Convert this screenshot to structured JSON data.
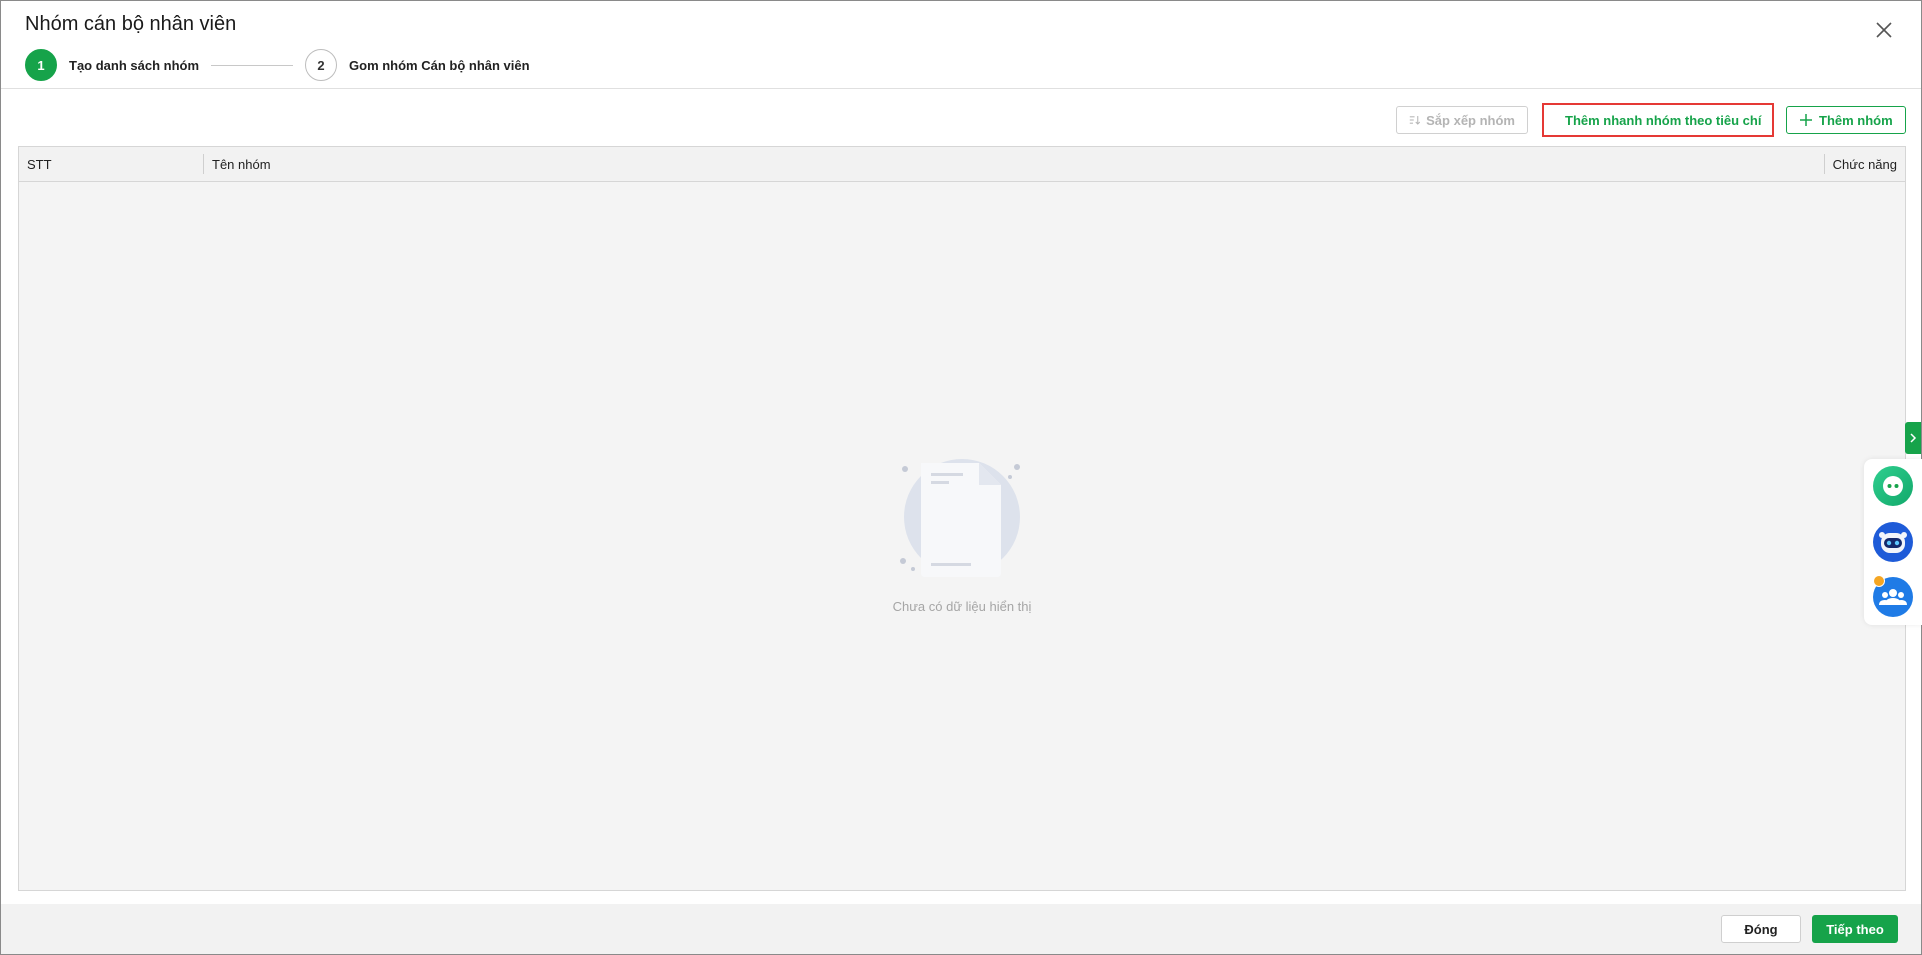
{
  "dialog": {
    "title": "Nhóm cán bộ nhân viên"
  },
  "steps": [
    {
      "number": "1",
      "label": "Tạo danh sách nhóm",
      "state": "active"
    },
    {
      "number": "2",
      "label": "Gom nhóm Cán bộ nhân viên",
      "state": "inactive"
    }
  ],
  "toolbar": {
    "sort_label": "Sắp xếp nhóm",
    "quick_add_label": "Thêm nhanh nhóm theo tiêu chí",
    "add_label": "Thêm nhóm"
  },
  "table": {
    "columns": [
      "STT",
      "Tên nhóm",
      "Chức năng"
    ],
    "rows": [],
    "empty_text": "Chưa có dữ liệu hiển thị"
  },
  "footer": {
    "close_label": "Đóng",
    "next_label": "Tiếp theo"
  },
  "colors": {
    "accent": "#16a34a",
    "highlight": "#e53935",
    "notify": "#f5a623"
  },
  "icons": {
    "close": "close-icon",
    "sort": "sort-icon",
    "plus": "plus-icon",
    "empty": "empty-document-icon",
    "side_toggle": "chevron-right-icon",
    "assistant_1": "chat-bot-icon",
    "assistant_2": "robot-assistant-icon",
    "community": "community-icon"
  }
}
